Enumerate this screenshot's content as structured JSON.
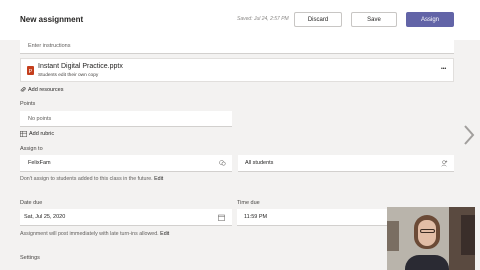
{
  "header": {
    "title": "New assignment",
    "saved_status": "Saved: Jul 24, 2:57 PM",
    "discard_label": "Discard",
    "save_label": "Save",
    "assign_label": "Assign"
  },
  "instructions": {
    "placeholder": "Enter instructions"
  },
  "attachment": {
    "file_name": "Instant Digital Practice.pptx",
    "permission": "Students edit their own copy",
    "more_glyph": "•••"
  },
  "resources": {
    "add_label": "Add resources"
  },
  "points": {
    "label": "Points",
    "value": "No points",
    "add_rubric_label": "Add rubric"
  },
  "assign_to": {
    "label": "Assign to",
    "class_value": "FelixFam",
    "students_value": "All students",
    "note_text": "Don't assign to students added to this class in the future.",
    "note_link": "Edit"
  },
  "date_due": {
    "label": "Date due",
    "value": "Sat, Jul 25, 2020"
  },
  "time_due": {
    "label": "Time due",
    "value": "11:59 PM"
  },
  "post_note": {
    "text": "Assignment will post immediately with late turn-ins allowed.",
    "link": "Edit"
  },
  "settings": {
    "label": "Settings"
  },
  "colors": {
    "accent": "#6264a7",
    "file_icon": "#c43e1c",
    "background": "#f3f2f1"
  }
}
